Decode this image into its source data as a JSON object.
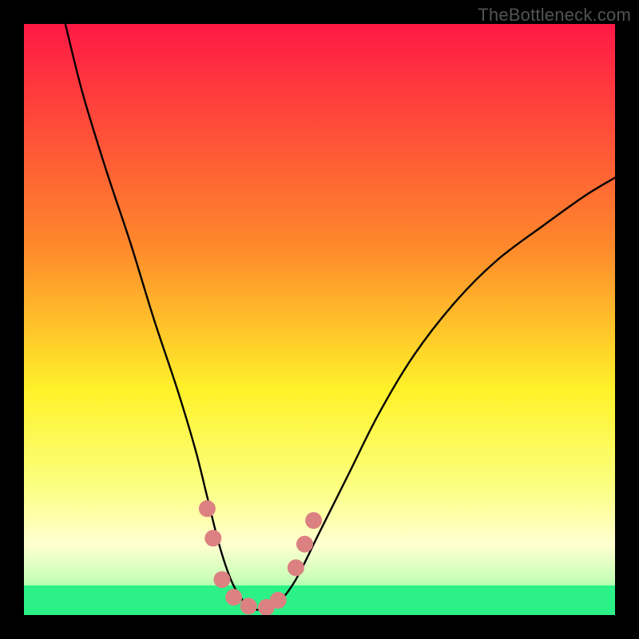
{
  "watermark": "TheBottleneck.com",
  "colors": {
    "frame": "#000000",
    "curve": "#000000",
    "marker_fill": "#dc8181",
    "marker_stroke": "#b05a5a",
    "good_band": "#2bf187",
    "gradient_top": "#ff1845",
    "gradient_mid1": "#ff8a2b",
    "gradient_mid2": "#fff22a",
    "gradient_mid3": "#fbff7e",
    "gradient_bottom": "#2bf187"
  },
  "chart_data": {
    "type": "line",
    "title": "",
    "xlabel": "",
    "ylabel": "",
    "x_range": [
      0,
      100
    ],
    "y_range": [
      0,
      100
    ],
    "note": "No axis tick labels present; values estimated from relative pixel positions within the plot area (0-100 normalized). y=100 at top, y=0 at bottom.",
    "series": [
      {
        "name": "bottleneck-curve",
        "x": [
          7,
          10,
          14,
          18,
          22,
          26,
          29,
          31,
          33,
          35,
          37,
          39,
          41,
          43,
          46,
          50,
          55,
          60,
          66,
          73,
          80,
          88,
          95,
          100
        ],
        "y": [
          100,
          88,
          75,
          63,
          50,
          38,
          28,
          20,
          12,
          6,
          2.5,
          1,
          1,
          2,
          6,
          14,
          24,
          34,
          44,
          53,
          60,
          66,
          71,
          74
        ]
      }
    ],
    "markers": {
      "name": "highlighted-points",
      "points": [
        {
          "x": 31,
          "y": 18
        },
        {
          "x": 32,
          "y": 13
        },
        {
          "x": 33.5,
          "y": 6
        },
        {
          "x": 35.5,
          "y": 3
        },
        {
          "x": 38,
          "y": 1.5
        },
        {
          "x": 41,
          "y": 1.3
        },
        {
          "x": 43,
          "y": 2.5
        },
        {
          "x": 46,
          "y": 8
        },
        {
          "x": 47.5,
          "y": 12
        },
        {
          "x": 49,
          "y": 16
        }
      ]
    },
    "good_zone_y_threshold": 5
  }
}
